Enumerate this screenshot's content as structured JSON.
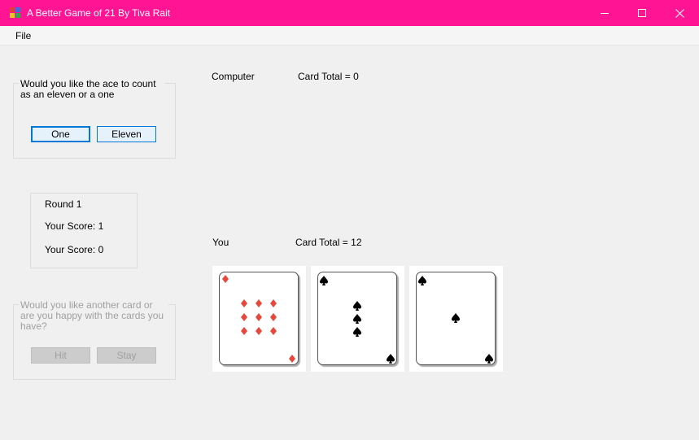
{
  "window": {
    "title": "A Better Game of 21 By Tiva Rait",
    "titlebar_color": "#ff1493",
    "controls": {
      "minimize_icon": "minimize-icon",
      "maximize_icon": "maximize-icon",
      "close_icon": "close-icon"
    }
  },
  "menu": {
    "file_label": "File"
  },
  "ace_choice": {
    "prompt": "Would you like the ace to count as an eleven or a one",
    "one_label": "One",
    "eleven_label": "Eleven"
  },
  "scoreboard": {
    "round": "Round 1",
    "score_1": "Your Score: 1",
    "score_2": "Your Score: 0"
  },
  "hit_stay": {
    "prompt": "Would you like another card or are you happy with the cards you have?",
    "hit_label": "Hit",
    "stay_label": "Stay"
  },
  "computer": {
    "label": "Computer",
    "total": "Card Total = 0"
  },
  "player": {
    "label": "You",
    "total": "Card Total = 12",
    "cards": [
      {
        "rank": "9",
        "suit": "diamonds",
        "color": "#e8483c"
      },
      {
        "rank": "3",
        "suit": "spades",
        "color": "#000000"
      },
      {
        "rank": "A",
        "suit": "spades",
        "color": "#000000"
      }
    ]
  }
}
